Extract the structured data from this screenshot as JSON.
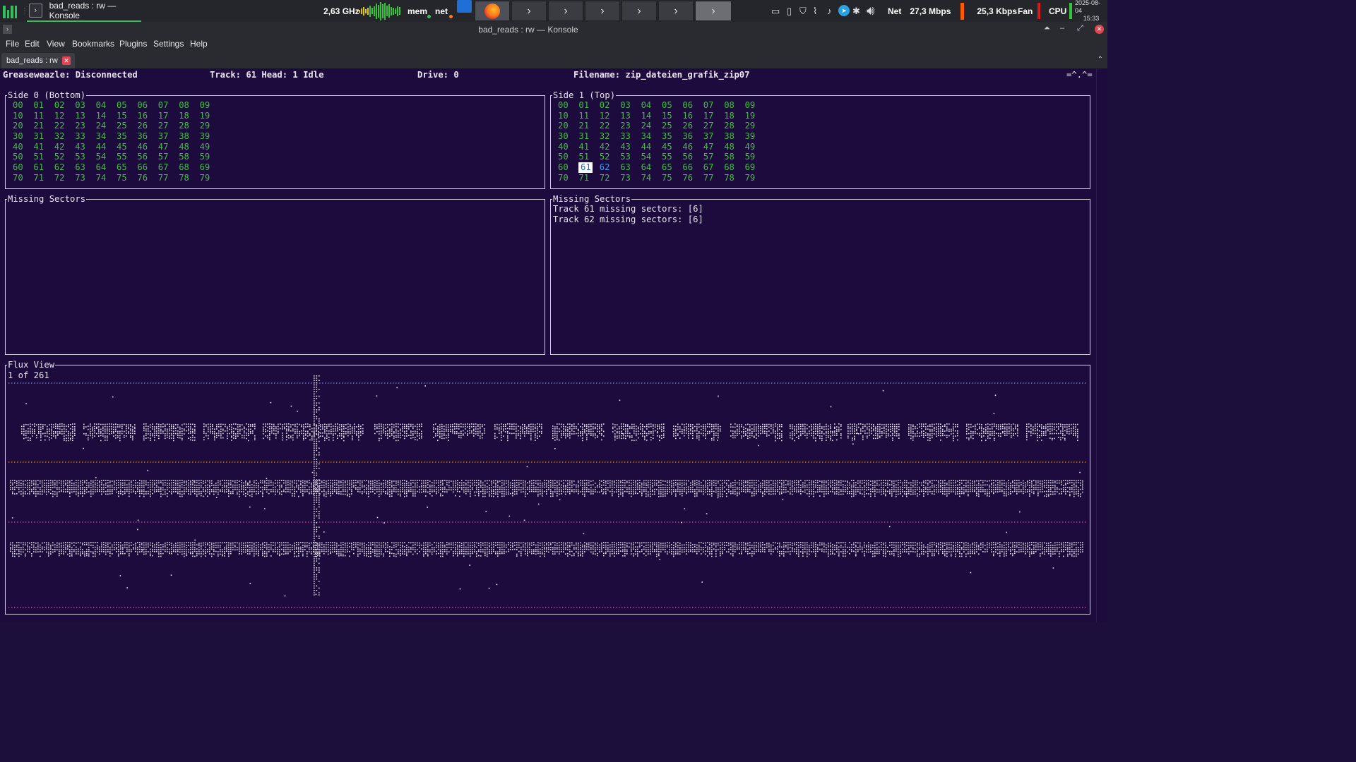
{
  "panel": {
    "task_title": "bad_reads : rw — Konsole",
    "cpu_freq": "2,63 GHz",
    "mem_label": "mem",
    "net_label": "net",
    "net_text": "Net",
    "net_down": "27,3 Mbps",
    "net_up": "25,3 Kbps",
    "fan_label": "Fan",
    "cpu_label": "CPU",
    "date": "2025-08-04",
    "time": "15:33"
  },
  "window": {
    "title": "bad_reads : rw — Konsole"
  },
  "menu": {
    "file": "File",
    "edit": "Edit",
    "view": "View",
    "bookmarks": "Bookmarks",
    "plugins": "Plugins",
    "settings": "Settings",
    "help": "Help"
  },
  "tab": {
    "label": "bad_reads : rw"
  },
  "status": {
    "connection": "Greaseweazle: Disconnected",
    "track": "Track: 61 Head: 1 Idle",
    "drive": "Drive: 0",
    "filename": "Filename: zip_dateien_grafik_zip07",
    "indicator": "=^.^="
  },
  "side0": {
    "title": "Side 0 (Bottom)",
    "tracks": [
      [
        "00",
        "01",
        "02",
        "03",
        "04",
        "05",
        "06",
        "07",
        "08",
        "09"
      ],
      [
        "10",
        "11",
        "12",
        "13",
        "14",
        "15",
        "16",
        "17",
        "18",
        "19"
      ],
      [
        "20",
        "21",
        "22",
        "23",
        "24",
        "25",
        "26",
        "27",
        "28",
        "29"
      ],
      [
        "30",
        "31",
        "32",
        "33",
        "34",
        "35",
        "36",
        "37",
        "38",
        "39"
      ],
      [
        "40",
        "41",
        "42",
        "43",
        "44",
        "45",
        "46",
        "47",
        "48",
        "49"
      ],
      [
        "50",
        "51",
        "52",
        "53",
        "54",
        "55",
        "56",
        "57",
        "58",
        "59"
      ],
      [
        "60",
        "61",
        "62",
        "63",
        "64",
        "65",
        "66",
        "67",
        "68",
        "69"
      ],
      [
        "70",
        "71",
        "72",
        "73",
        "74",
        "75",
        "76",
        "77",
        "78",
        "79"
      ]
    ]
  },
  "side1": {
    "title": "Side 1 (Top)",
    "tracks": [
      [
        "00",
        "01",
        "02",
        "03",
        "04",
        "05",
        "06",
        "07",
        "08",
        "09"
      ],
      [
        "10",
        "11",
        "12",
        "13",
        "14",
        "15",
        "16",
        "17",
        "18",
        "19"
      ],
      [
        "20",
        "21",
        "22",
        "23",
        "24",
        "25",
        "26",
        "27",
        "28",
        "29"
      ],
      [
        "30",
        "31",
        "32",
        "33",
        "34",
        "35",
        "36",
        "37",
        "38",
        "39"
      ],
      [
        "40",
        "41",
        "42",
        "43",
        "44",
        "45",
        "46",
        "47",
        "48",
        "49"
      ],
      [
        "50",
        "51",
        "52",
        "53",
        "54",
        "55",
        "56",
        "57",
        "58",
        "59"
      ],
      [
        "60",
        "61",
        "62",
        "63",
        "64",
        "65",
        "66",
        "67",
        "68",
        "69"
      ],
      [
        "70",
        "71",
        "72",
        "73",
        "74",
        "75",
        "76",
        "77",
        "78",
        "79"
      ]
    ],
    "current_track": "61",
    "next_track": "62"
  },
  "missing0": {
    "title": "Missing Sectors",
    "lines": []
  },
  "missing1": {
    "title": "Missing Sectors",
    "lines": [
      "Track 61 missing sectors: [6]",
      "Track 62 missing sectors: [6]"
    ]
  },
  "flux": {
    "title": "Flux View",
    "page": "1 of 261"
  },
  "colors": {
    "terminal_bg": "#1e0b3d",
    "track_ok": "#3fbf3f",
    "track_current_bg": "#ffffff",
    "track_pending": "#3a97ee",
    "dotted_blue": "#8a8ad8",
    "dotted_orange": "#e08a1c",
    "dotted_pink": "#c84ab0"
  }
}
